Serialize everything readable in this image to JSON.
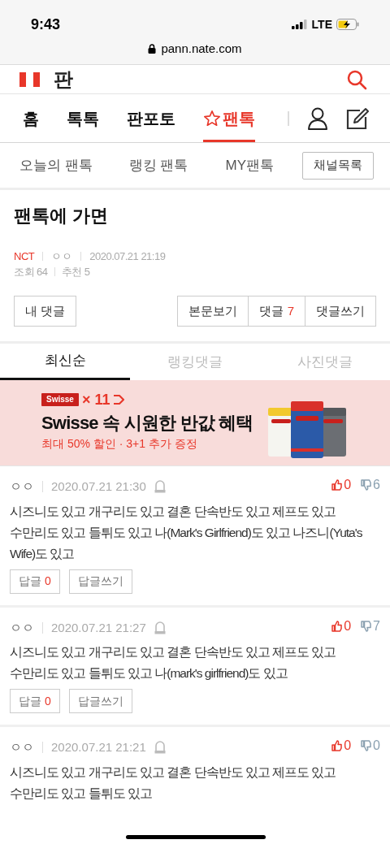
{
  "status_bar": {
    "time": "9:43",
    "network": "LTE"
  },
  "browser": {
    "url": "pann.nate.com"
  },
  "header": {
    "logo": "판"
  },
  "nav": {
    "items": [
      {
        "label": "홈",
        "selected": false
      },
      {
        "label": "톡톡",
        "selected": false
      },
      {
        "label": "판포토",
        "selected": false
      },
      {
        "label": "팬톡",
        "selected": true,
        "kind": "star"
      }
    ]
  },
  "subnav": {
    "items": [
      "오늘의 팬톡",
      "랭킹 팬톡",
      "MY팬톡"
    ],
    "channel_button": "채널목록"
  },
  "post": {
    "title": "팬톡에 가면",
    "channel": "NCT",
    "author": "ㅇㅇ",
    "date": "2020.07.21 21:19",
    "views_label": "조회",
    "views": "64",
    "recommend_label": "추천",
    "recommend": "5"
  },
  "actions": {
    "my_comments": "내 댓글",
    "view_post": "본문보기",
    "comments_label": "댓글",
    "comments_count": "7",
    "write_comment": "댓글쓰기"
  },
  "comment_tabs": [
    {
      "label": "최신순",
      "selected": true
    },
    {
      "label": "랭킹댓글",
      "selected": false
    },
    {
      "label": "사진댓글",
      "selected": false
    }
  ],
  "ad": {
    "brand": "Swisse",
    "partner": "× 11",
    "headline": "Swisse 속 시원한 반값 혜택",
    "subline": "최대 50% 할인 · 3+1 추가 증정",
    "kind": "picture"
  },
  "comments": [
    {
      "author": "ㅇㅇ",
      "date": "2020.07.21 21:30",
      "likes": "0",
      "dislikes": "6",
      "text": "시즈니도 있고 개구리도 있고 결혼 단속반도 있고 제프도 있고 수만리도 있고 들튀도 있고 나(Mark's Girlfriend)도 있고 나즈니(Yuta's Wife)도 있고",
      "reply_label": "답글",
      "replies": "0",
      "write_reply": "답글쓰기"
    },
    {
      "author": "ㅇㅇ",
      "date": "2020.07.21 21:27",
      "likes": "0",
      "dislikes": "7",
      "text": "시즈니도 있고 개구리도 있고 결혼 단속반도 있고 제프도 있고 수만리도 있고 들튀도 있고 나(mark's girlfriend)도 있고",
      "reply_label": "답글",
      "replies": "0",
      "write_reply": "답글쓰기"
    },
    {
      "author": "ㅇㅇ",
      "date": "2020.07.21 21:21",
      "likes": "0",
      "dislikes": "0",
      "text": "시즈니도 있고 개구리도 있고 결혼 단속반도 있고 제프도 있고 수만리도 있고 들튀도 있고"
    }
  ]
}
